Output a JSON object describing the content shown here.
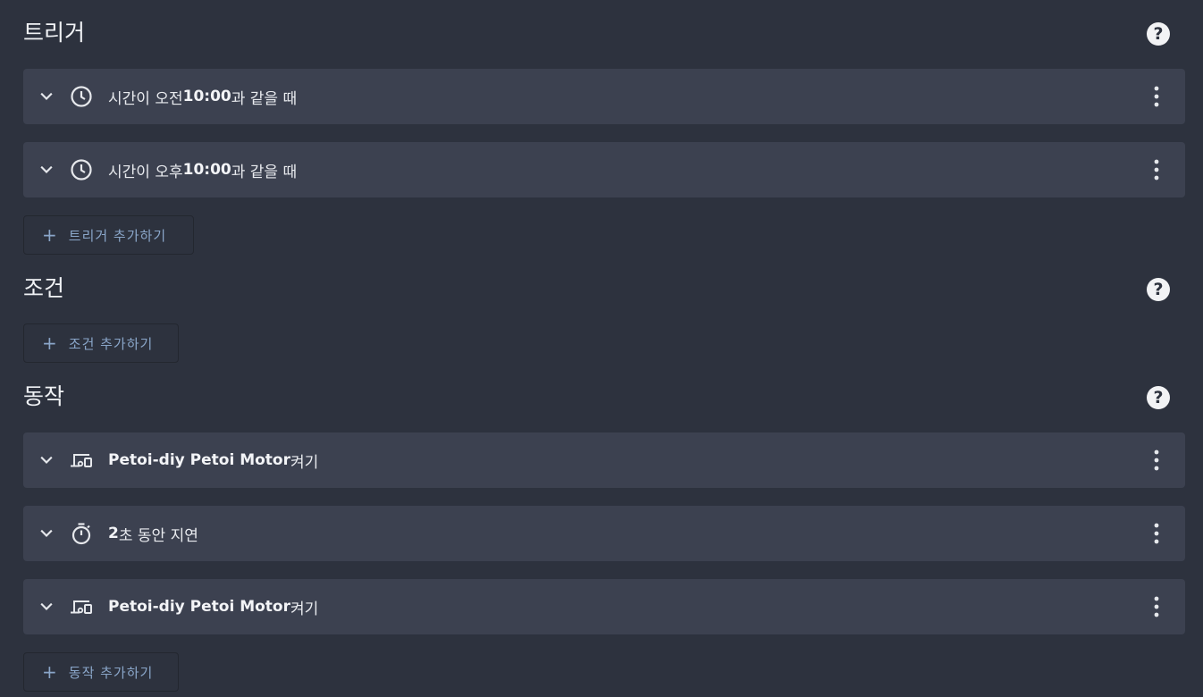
{
  "triggers": {
    "title": "트리거",
    "items": [
      {
        "prefix": "시간이 오전 ",
        "bold": "10:00",
        "suffix": "과 같을 때",
        "icon": "clock-icon"
      },
      {
        "prefix": "시간이 오후 ",
        "bold": "10:00",
        "suffix": "과 같을 때",
        "icon": "clock-icon"
      }
    ],
    "add_label": "트리거 추가하기"
  },
  "conditions": {
    "title": "조건",
    "add_label": "조건 추가하기"
  },
  "actions": {
    "title": "동작",
    "items": [
      {
        "prefix": "",
        "bold": "Petoi-diy Petoi Motor",
        "suffix": " 켜기",
        "icon": "devices-icon"
      },
      {
        "prefix": "",
        "bold": "2",
        "suffix": "초 동안 지연",
        "icon": "timer-icon"
      },
      {
        "prefix": "",
        "bold": "Petoi-diy Petoi Motor",
        "suffix": " 켜기",
        "icon": "devices-icon"
      }
    ],
    "add_label": "동작 추가하기"
  },
  "help_glyph": "?",
  "plus_glyph": "+",
  "colors": {
    "background": "#2d323e",
    "card": "#3c4150",
    "accent": "#8aa6c9"
  }
}
